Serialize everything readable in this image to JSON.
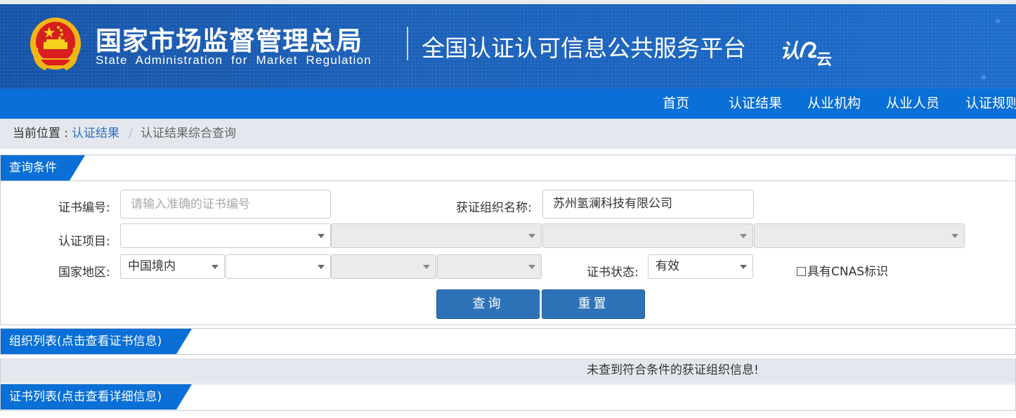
{
  "header": {
    "agency_name_cn": "国家市场监督管理总局",
    "agency_name_en": "State Administration for Market Regulation",
    "platform_title": "全国认证认可信息公共服务平台",
    "logo_text": "认e云"
  },
  "nav": {
    "items": [
      "首页",
      "认证结果",
      "从业机构",
      "从业人员",
      "认证规则"
    ]
  },
  "breadcrumb": {
    "prefix": "当前位置 :",
    "link": "认证结果",
    "separator": "/",
    "current": "认证结果综合查询"
  },
  "query_panel": {
    "title": "查询条件",
    "cert_no_label": "证书编号:",
    "cert_no_placeholder": "请输入准确的证书编号",
    "cert_no_value": "",
    "org_name_label": "获证组织名称:",
    "org_name_value": "苏州氢澜科技有限公司",
    "project_label": "认证项目:",
    "region_label": "国家地区:",
    "region_value": "中国境内",
    "status_label": "证书状态:",
    "status_value": "有效",
    "cnas_label": "具有CNAS标识",
    "search_button": "查询",
    "reset_button": "重置"
  },
  "org_list": {
    "title": "组织列表(点击查看证书信息)",
    "empty_message": "未查到符合条件的获证组织信息!"
  },
  "cert_list": {
    "title": "证书列表(点击查看详细信息)"
  },
  "colors": {
    "banner": "#1a5fb8",
    "nav": "#0a6fd6",
    "button": "#2e73b8",
    "link": "#2a6fc0"
  }
}
